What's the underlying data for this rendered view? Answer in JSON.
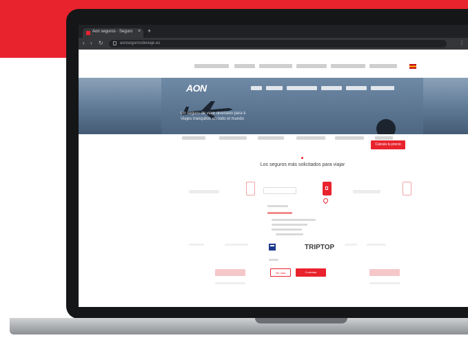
{
  "browser": {
    "tab_title": "Aon seguros · Seguro",
    "url": "aonsegurosdeviaje.es"
  },
  "site": {
    "logo": "AON",
    "hero_headline": "Un seguro de viaje diseñado para ti",
    "hero_subline": "Viajes tranquilos en todo el mundo",
    "quote_cta": "Calcula tu precio",
    "section_title": "Los seguros más solicitados para viajar",
    "partner_name": "TRIPTOP",
    "outline_button": "Ver más",
    "solid_button": "Contratar"
  },
  "colors": {
    "brand_red": "#e8232d",
    "hero_blue": "#5f7994"
  },
  "icons": {
    "lock": "lock-icon",
    "pin": "map-pin-icon",
    "plane": "airplane-icon"
  }
}
